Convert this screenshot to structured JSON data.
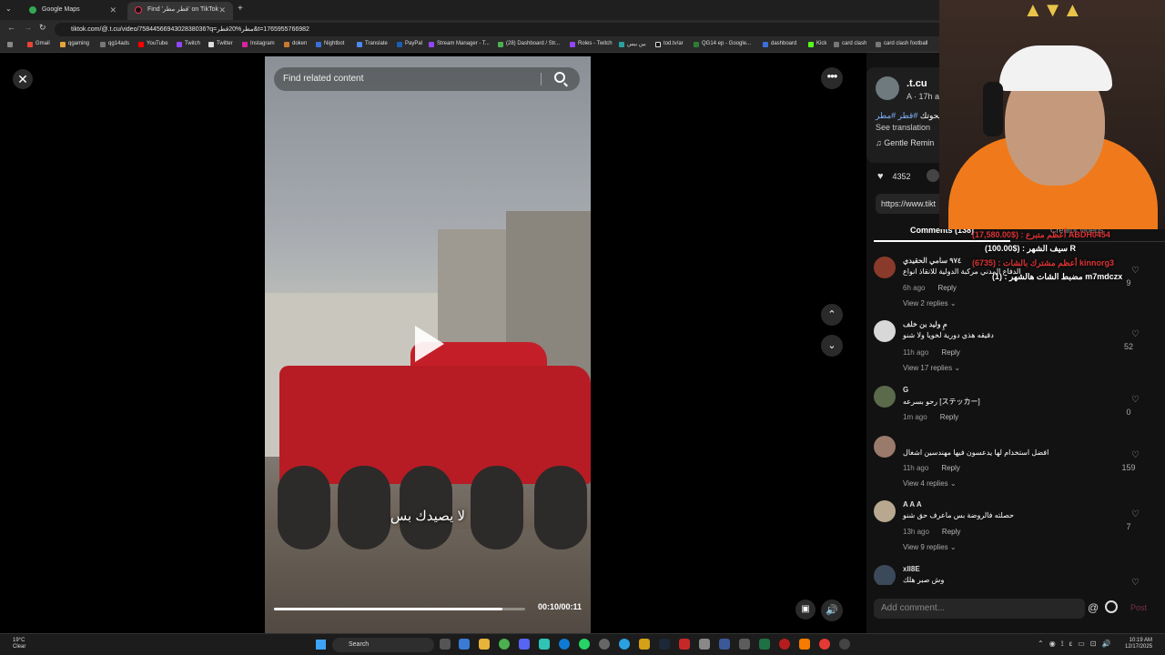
{
  "browser": {
    "tabs": [
      {
        "title": "Google Maps"
      },
      {
        "title": "Find 'قطر مطر' on TikTok | TikTok"
      }
    ],
    "url": "tiktok.com/@.t.cu/video/7584456694302838036?q=مطر%20قطر&t=1765955766982",
    "bookmarks": [
      "Gmail",
      "qgaming",
      "qg14ads",
      "YouTube",
      "Twitch",
      "Twitter",
      "Instagram",
      "doken",
      "Nightbot",
      "Translate",
      "PayPal",
      "Stream Manager - T...",
      "(28) Dashboard / Str...",
      "Roles - Twitch",
      "بین بیس",
      "tod.tv/ar",
      "QG14 ep - Google...",
      "dashboard",
      "Kick",
      "card clash",
      "card clash football"
    ]
  },
  "video": {
    "search_placeholder": "Find related content",
    "subtitle": "لا يصيدك بس",
    "time": "00:10/00:11",
    "progress": 0.91
  },
  "author": {
    "name": ".t.cu",
    "meta": "A · 17h ag",
    "caption_hashtags": "#قطر #مطر",
    "caption_text": "لا يحوتك",
    "see_translation": "See translation",
    "music": "♫  Gentle Remin",
    "likes": "4352",
    "link": "https://www.tikt"
  },
  "tabs": {
    "comments": "Comments (138)",
    "creator": "Creator videos"
  },
  "comments": [
    {
      "user": "٩٧٤ سامي الحقيدي",
      "text": "الدفاع المدني مركبة الدولية للانقاذ انواع",
      "time": "6h ago",
      "reply": "Reply",
      "replies": "View 2 replies",
      "likes": "9",
      "avatar_color": "#8a3a2a"
    },
    {
      "user": "مِ وليد بن خلف",
      "text": "دقيقه هذي دورية لخويا ولا شنو",
      "time": "11h ago",
      "reply": "Reply",
      "replies": "View 17 replies",
      "likes": "52",
      "avatar_color": "#d8d8d8"
    },
    {
      "user": "G",
      "text": "رحو بسرعه [ステッカー]",
      "time": "1m ago",
      "reply": "Reply",
      "replies": "",
      "likes": "0",
      "avatar_color": "#5a6a4a"
    },
    {
      "user": "",
      "text": "افضل استخدام لها يدعسون فيها مهندسين اشغال",
      "time": "11h ago",
      "reply": "Reply",
      "replies": "View 4 replies",
      "likes": "159",
      "avatar_color": "#9a7a6a"
    },
    {
      "user": "A A A",
      "text": "حصلته فالروضة بس ماعرف حق شنو",
      "time": "13h ago",
      "reply": "Reply",
      "replies": "View 9 replies",
      "likes": "7",
      "avatar_color": "#b8a890"
    },
    {
      "user": "xll8E",
      "text": "وش صبر هلك",
      "time": "",
      "reply": "",
      "replies": "",
      "likes": "",
      "avatar_color": "#3a4a5a"
    }
  ],
  "comment_box": {
    "placeholder": "Add comment...",
    "at": "@",
    "post": "Post"
  },
  "stream_overlay": {
    "line1": "سيف الشهر : ($100.00) R",
    "line2": "أعظم مشترك بالشات : (6735) kinnorg3",
    "line3": "مضبط الشات هالشهر : (1) m7mdczx",
    "line0": "أعظم متبرع : ($17,580.00) ABDH0454"
  },
  "taskbar": {
    "weather_temp": "19°C",
    "weather_desc": "Clear",
    "search": "Search",
    "time": "10:19 AM",
    "date": "12/17/2025"
  },
  "colors": {
    "accent": "#fe2c55",
    "hashtag": "#7fb3ff"
  }
}
